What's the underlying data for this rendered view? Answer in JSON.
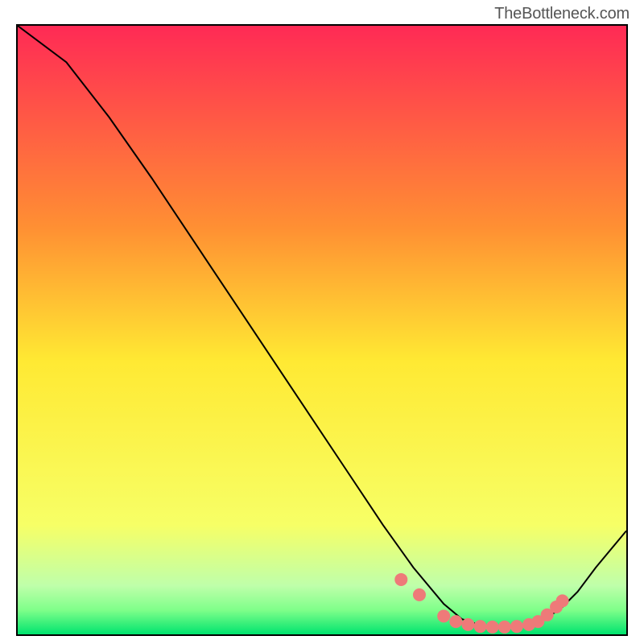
{
  "attribution": "TheBottleneck.com",
  "palette": {
    "stop0": "#ff2a55",
    "stop33": "#ff8f33",
    "stop55": "#ffe933",
    "stop82": "#f7ff66",
    "stop92": "#bfffaa",
    "stop96": "#7fff8a",
    "stop100": "#00e36e"
  },
  "chart_data": {
    "type": "line",
    "title": "",
    "xlabel": "",
    "ylabel": "",
    "xlim": [
      0,
      100
    ],
    "ylim": [
      0,
      100
    ],
    "series": [
      {
        "name": "bottleneck-curve",
        "x": [
          0,
          8,
          15,
          22,
          30,
          38,
          46,
          54,
          60,
          65,
          70,
          73,
          76,
          78,
          80,
          82,
          84,
          86,
          89,
          92,
          95,
          100
        ],
        "y": [
          100,
          94,
          85,
          75,
          63,
          51,
          39,
          27,
          18,
          11,
          5,
          2.5,
          1.5,
          1.2,
          1.1,
          1.2,
          1.6,
          2.3,
          4,
          7,
          11,
          17
        ]
      }
    ],
    "markers": {
      "name": "highlighted-points",
      "x": [
        63,
        66,
        70,
        72,
        74,
        76,
        78,
        80,
        82,
        84,
        85.5,
        87,
        88.5,
        89.5
      ],
      "y": [
        9,
        6.5,
        3,
        2.1,
        1.6,
        1.3,
        1.2,
        1.2,
        1.3,
        1.6,
        2.1,
        3.2,
        4.5,
        5.5
      ]
    }
  }
}
